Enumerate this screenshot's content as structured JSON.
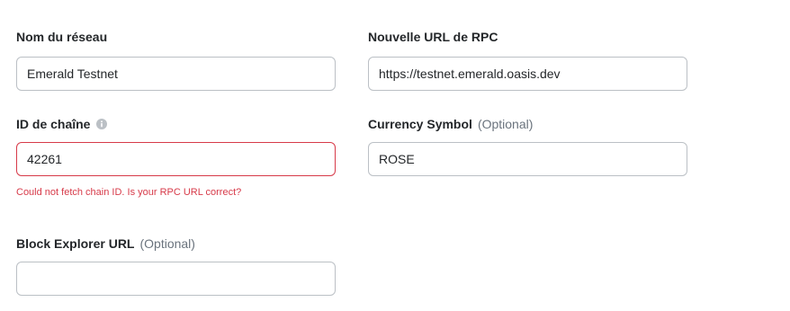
{
  "fields": {
    "network_name": {
      "label": "Nom du réseau",
      "value": "Emerald Testnet"
    },
    "rpc_url": {
      "label": "Nouvelle URL de RPC",
      "value": "https://testnet.emerald.oasis.dev"
    },
    "chain_id": {
      "label": "ID de chaîne",
      "value": "42261",
      "error": "Could not fetch chain ID. Is your RPC URL correct?",
      "info_icon": "info-icon"
    },
    "currency_symbol": {
      "label": "Currency Symbol",
      "optional": "(Optional)",
      "value": "ROSE"
    },
    "block_explorer": {
      "label": "Block Explorer URL",
      "optional": "(Optional)",
      "value": ""
    }
  },
  "colors": {
    "error": "#d73a49",
    "border": "#bbc0c5",
    "label": "#24272a",
    "muted": "#6a737d"
  }
}
